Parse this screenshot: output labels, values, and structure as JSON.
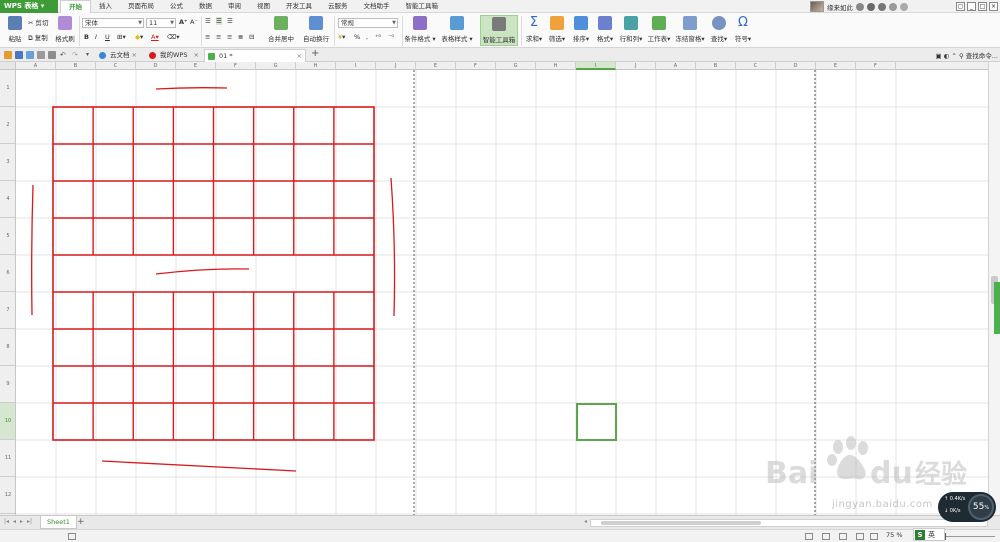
{
  "menubar": {
    "app_name": "WPS 表格",
    "tabs": [
      {
        "label": "开始",
        "active": true
      },
      {
        "label": "插入",
        "active": false
      },
      {
        "label": "页面布局",
        "active": false
      },
      {
        "label": "公式",
        "active": false
      },
      {
        "label": "数据",
        "active": false
      },
      {
        "label": "审阅",
        "active": false
      },
      {
        "label": "视图",
        "active": false
      },
      {
        "label": "开发工具",
        "active": false
      },
      {
        "label": "云服务",
        "active": false
      },
      {
        "label": "文档助手",
        "active": false
      },
      {
        "label": "智能工具箱",
        "active": false
      }
    ],
    "user_name": "缘来如此"
  },
  "ribbon": {
    "paste": "粘贴",
    "cut": "剪切",
    "copy": "复制",
    "format_painter": "格式刷",
    "font_name": "宋体",
    "font_size": "11",
    "bold": "B",
    "italic": "I",
    "underline": "U",
    "font_color_glyph": "A",
    "merge_center": "合并居中",
    "auto_wrap": "自动换行",
    "number_format": "常规",
    "percent": "%",
    "cond_format": "条件格式",
    "table_style": "表格样式",
    "smart_toolbox": "智能工具箱",
    "sum": "求和",
    "filter": "筛选",
    "sort": "排序",
    "format": "格式",
    "row_col": "行和列",
    "worksheet": "工作表",
    "freeze": "冻结窗格",
    "find": "查找",
    "symbol": "符号"
  },
  "tabbar": {
    "tabs": [
      {
        "label": "云文档"
      },
      {
        "label": "我的WPS"
      },
      {
        "label": "01 *"
      }
    ],
    "find_command": "查找命令..."
  },
  "grid": {
    "columns": [
      "A",
      "B",
      "C",
      "D",
      "E",
      "F",
      "G",
      "H",
      "I",
      "J",
      "E",
      "F",
      "G",
      "H",
      "I",
      "J",
      "A",
      "B",
      "C",
      "D",
      "E",
      "F"
    ],
    "selected_column_index": 14,
    "rows": [
      "1",
      "2",
      "3",
      "4",
      "5",
      "6",
      "7",
      "8",
      "9",
      "10",
      "11",
      "12"
    ],
    "selected_row_index": 9
  },
  "sheetbar": {
    "sheet_name": "Sheet1",
    "add_glyph": "+"
  },
  "status": {
    "zoom": "75 %",
    "zoom_level_percent": 75
  },
  "overlay": {
    "speed_value": "55",
    "speed_unit": "%",
    "upload": "0.4K/s",
    "download": "0K/s",
    "ime_glyph": "S",
    "ime_lang": "英",
    "watermark_url": "jingyan.baidu.com"
  },
  "colors": {
    "accent": "#3f9b37",
    "drawing_red": "#d9191c",
    "selection_green": "#5aa64c"
  }
}
